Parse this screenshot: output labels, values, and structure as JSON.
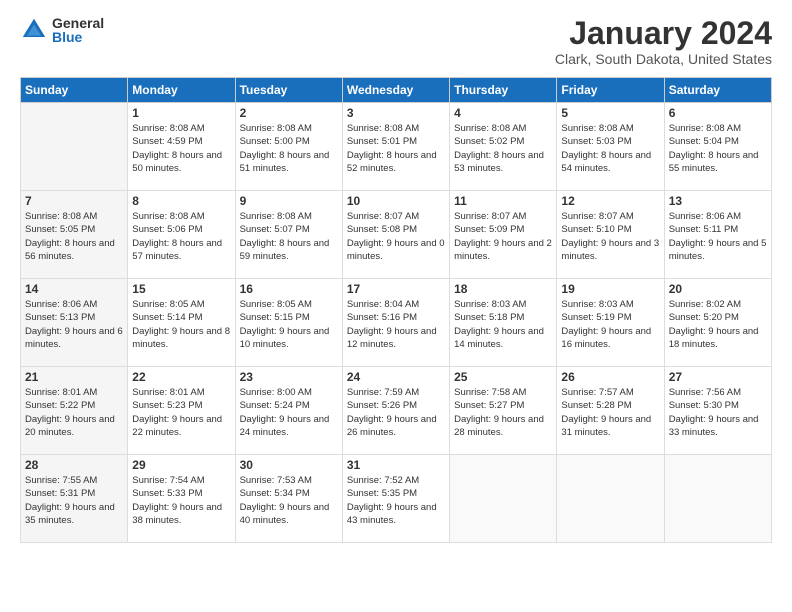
{
  "logo": {
    "general": "General",
    "blue": "Blue"
  },
  "title": "January 2024",
  "location": "Clark, South Dakota, United States",
  "days_header": [
    "Sunday",
    "Monday",
    "Tuesday",
    "Wednesday",
    "Thursday",
    "Friday",
    "Saturday"
  ],
  "weeks": [
    [
      {
        "num": "",
        "sunrise": "",
        "sunset": "",
        "daylight": ""
      },
      {
        "num": "1",
        "sunrise": "Sunrise: 8:08 AM",
        "sunset": "Sunset: 4:59 PM",
        "daylight": "Daylight: 8 hours and 50 minutes."
      },
      {
        "num": "2",
        "sunrise": "Sunrise: 8:08 AM",
        "sunset": "Sunset: 5:00 PM",
        "daylight": "Daylight: 8 hours and 51 minutes."
      },
      {
        "num": "3",
        "sunrise": "Sunrise: 8:08 AM",
        "sunset": "Sunset: 5:01 PM",
        "daylight": "Daylight: 8 hours and 52 minutes."
      },
      {
        "num": "4",
        "sunrise": "Sunrise: 8:08 AM",
        "sunset": "Sunset: 5:02 PM",
        "daylight": "Daylight: 8 hours and 53 minutes."
      },
      {
        "num": "5",
        "sunrise": "Sunrise: 8:08 AM",
        "sunset": "Sunset: 5:03 PM",
        "daylight": "Daylight: 8 hours and 54 minutes."
      },
      {
        "num": "6",
        "sunrise": "Sunrise: 8:08 AM",
        "sunset": "Sunset: 5:04 PM",
        "daylight": "Daylight: 8 hours and 55 minutes."
      }
    ],
    [
      {
        "num": "7",
        "sunrise": "Sunrise: 8:08 AM",
        "sunset": "Sunset: 5:05 PM",
        "daylight": "Daylight: 8 hours and 56 minutes."
      },
      {
        "num": "8",
        "sunrise": "Sunrise: 8:08 AM",
        "sunset": "Sunset: 5:06 PM",
        "daylight": "Daylight: 8 hours and 57 minutes."
      },
      {
        "num": "9",
        "sunrise": "Sunrise: 8:08 AM",
        "sunset": "Sunset: 5:07 PM",
        "daylight": "Daylight: 8 hours and 59 minutes."
      },
      {
        "num": "10",
        "sunrise": "Sunrise: 8:07 AM",
        "sunset": "Sunset: 5:08 PM",
        "daylight": "Daylight: 9 hours and 0 minutes."
      },
      {
        "num": "11",
        "sunrise": "Sunrise: 8:07 AM",
        "sunset": "Sunset: 5:09 PM",
        "daylight": "Daylight: 9 hours and 2 minutes."
      },
      {
        "num": "12",
        "sunrise": "Sunrise: 8:07 AM",
        "sunset": "Sunset: 5:10 PM",
        "daylight": "Daylight: 9 hours and 3 minutes."
      },
      {
        "num": "13",
        "sunrise": "Sunrise: 8:06 AM",
        "sunset": "Sunset: 5:11 PM",
        "daylight": "Daylight: 9 hours and 5 minutes."
      }
    ],
    [
      {
        "num": "14",
        "sunrise": "Sunrise: 8:06 AM",
        "sunset": "Sunset: 5:13 PM",
        "daylight": "Daylight: 9 hours and 6 minutes."
      },
      {
        "num": "15",
        "sunrise": "Sunrise: 8:05 AM",
        "sunset": "Sunset: 5:14 PM",
        "daylight": "Daylight: 9 hours and 8 minutes."
      },
      {
        "num": "16",
        "sunrise": "Sunrise: 8:05 AM",
        "sunset": "Sunset: 5:15 PM",
        "daylight": "Daylight: 9 hours and 10 minutes."
      },
      {
        "num": "17",
        "sunrise": "Sunrise: 8:04 AM",
        "sunset": "Sunset: 5:16 PM",
        "daylight": "Daylight: 9 hours and 12 minutes."
      },
      {
        "num": "18",
        "sunrise": "Sunrise: 8:03 AM",
        "sunset": "Sunset: 5:18 PM",
        "daylight": "Daylight: 9 hours and 14 minutes."
      },
      {
        "num": "19",
        "sunrise": "Sunrise: 8:03 AM",
        "sunset": "Sunset: 5:19 PM",
        "daylight": "Daylight: 9 hours and 16 minutes."
      },
      {
        "num": "20",
        "sunrise": "Sunrise: 8:02 AM",
        "sunset": "Sunset: 5:20 PM",
        "daylight": "Daylight: 9 hours and 18 minutes."
      }
    ],
    [
      {
        "num": "21",
        "sunrise": "Sunrise: 8:01 AM",
        "sunset": "Sunset: 5:22 PM",
        "daylight": "Daylight: 9 hours and 20 minutes."
      },
      {
        "num": "22",
        "sunrise": "Sunrise: 8:01 AM",
        "sunset": "Sunset: 5:23 PM",
        "daylight": "Daylight: 9 hours and 22 minutes."
      },
      {
        "num": "23",
        "sunrise": "Sunrise: 8:00 AM",
        "sunset": "Sunset: 5:24 PM",
        "daylight": "Daylight: 9 hours and 24 minutes."
      },
      {
        "num": "24",
        "sunrise": "Sunrise: 7:59 AM",
        "sunset": "Sunset: 5:26 PM",
        "daylight": "Daylight: 9 hours and 26 minutes."
      },
      {
        "num": "25",
        "sunrise": "Sunrise: 7:58 AM",
        "sunset": "Sunset: 5:27 PM",
        "daylight": "Daylight: 9 hours and 28 minutes."
      },
      {
        "num": "26",
        "sunrise": "Sunrise: 7:57 AM",
        "sunset": "Sunset: 5:28 PM",
        "daylight": "Daylight: 9 hours and 31 minutes."
      },
      {
        "num": "27",
        "sunrise": "Sunrise: 7:56 AM",
        "sunset": "Sunset: 5:30 PM",
        "daylight": "Daylight: 9 hours and 33 minutes."
      }
    ],
    [
      {
        "num": "28",
        "sunrise": "Sunrise: 7:55 AM",
        "sunset": "Sunset: 5:31 PM",
        "daylight": "Daylight: 9 hours and 35 minutes."
      },
      {
        "num": "29",
        "sunrise": "Sunrise: 7:54 AM",
        "sunset": "Sunset: 5:33 PM",
        "daylight": "Daylight: 9 hours and 38 minutes."
      },
      {
        "num": "30",
        "sunrise": "Sunrise: 7:53 AM",
        "sunset": "Sunset: 5:34 PM",
        "daylight": "Daylight: 9 hours and 40 minutes."
      },
      {
        "num": "31",
        "sunrise": "Sunrise: 7:52 AM",
        "sunset": "Sunset: 5:35 PM",
        "daylight": "Daylight: 9 hours and 43 minutes."
      },
      {
        "num": "",
        "sunrise": "",
        "sunset": "",
        "daylight": ""
      },
      {
        "num": "",
        "sunrise": "",
        "sunset": "",
        "daylight": ""
      },
      {
        "num": "",
        "sunrise": "",
        "sunset": "",
        "daylight": ""
      }
    ]
  ]
}
